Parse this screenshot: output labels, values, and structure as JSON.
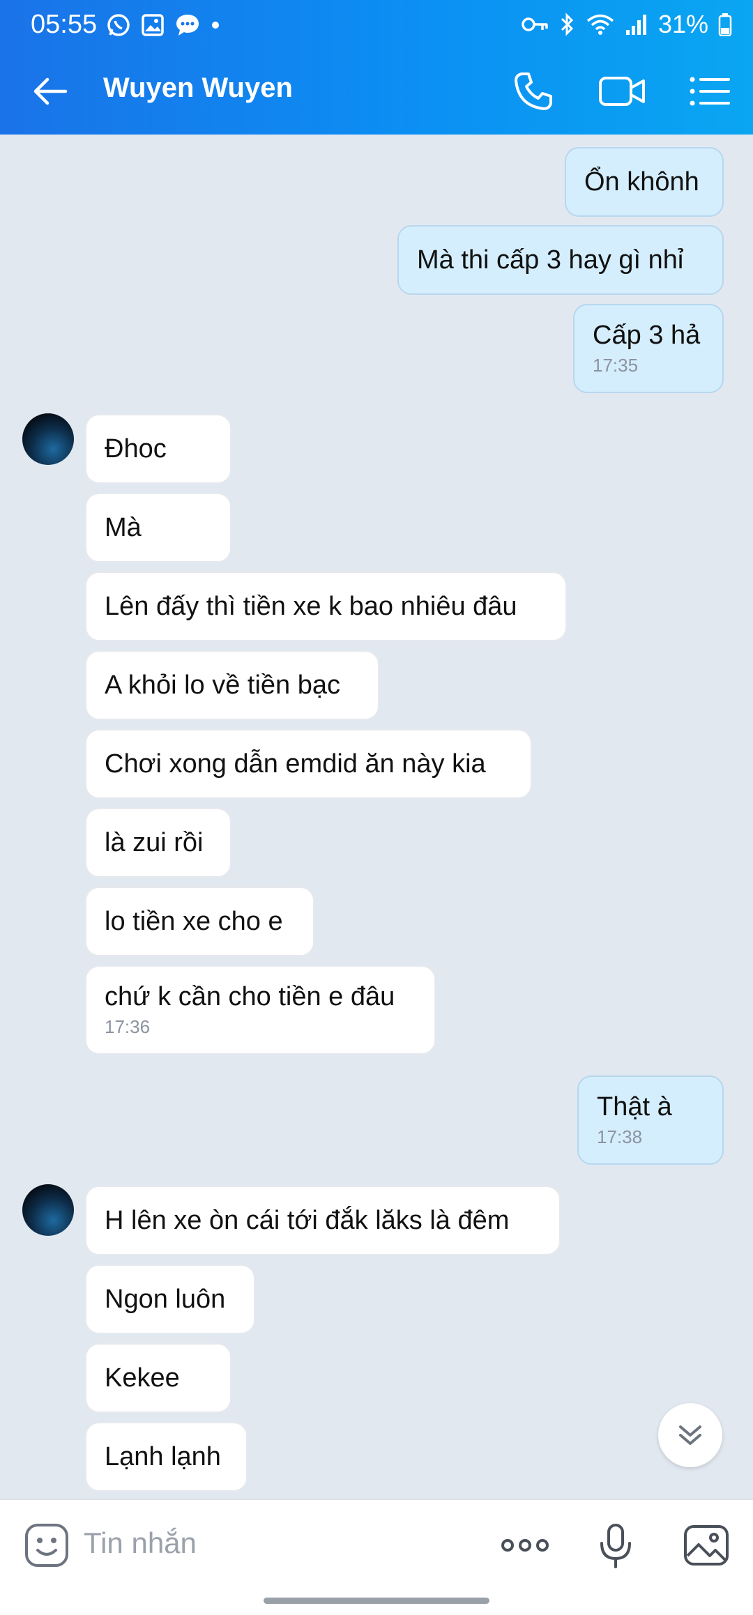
{
  "status_bar": {
    "time": "05:55",
    "battery": "31%"
  },
  "header": {
    "contact_name": "Wuyen Wuyen"
  },
  "messages": [
    {
      "from": "me",
      "text": "Ổn khônh"
    },
    {
      "from": "me",
      "text": "Mà thi cấp 3 hay gì nhỉ"
    },
    {
      "from": "me",
      "text": "Cấp 3 hả",
      "time": "17:35"
    },
    {
      "from": "them",
      "text": "Đhoc"
    },
    {
      "from": "them",
      "text": "Mà"
    },
    {
      "from": "them",
      "text": "Lên đấy thì tiền xe k bao nhiêu đâu"
    },
    {
      "from": "them",
      "text": "A khỏi lo về tiền bạc"
    },
    {
      "from": "them",
      "text": "Chơi xong dẫn emdid ăn này kia"
    },
    {
      "from": "them",
      "text": "là zui rồi"
    },
    {
      "from": "them",
      "text": "lo tiền xe cho e"
    },
    {
      "from": "them",
      "text": "chứ k cần cho tiền e đâu",
      "time": "17:36"
    },
    {
      "from": "me",
      "text": "Thật à",
      "time": "17:38"
    },
    {
      "from": "them",
      "text": "H lên xe òn cái tới đắk lăks là đêm"
    },
    {
      "from": "them",
      "text": "Ngon luôn"
    },
    {
      "from": "them",
      "text": "Kekee"
    },
    {
      "from": "them",
      "text": "Lạnh lạnh"
    }
  ],
  "input": {
    "placeholder": "Tin nhắn"
  },
  "colors": {
    "header_start": "#1a73e8",
    "header_end": "#0aa6f2",
    "bubble_me": "#d4eefe",
    "bubble_them": "#ffffff",
    "background": "#e2e8f0"
  },
  "icons": [
    "back-arrow",
    "phone",
    "video-camera",
    "list-menu",
    "sticker-face",
    "more-dots",
    "microphone",
    "image",
    "chevron-double-down"
  ]
}
